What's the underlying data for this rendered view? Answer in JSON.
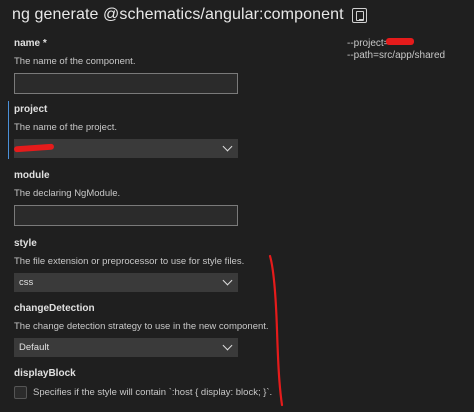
{
  "header": {
    "title": "ng generate @schematics/angular:component",
    "copy_icon": "copy-icon"
  },
  "side_note": {
    "line1": "--project=",
    "line2": "--path=src/app/shared"
  },
  "fields": {
    "name": {
      "label": "name *",
      "description": "The name of the component.",
      "value": ""
    },
    "project": {
      "label": "project",
      "description": "The name of the project.",
      "value": ""
    },
    "module": {
      "label": "module",
      "description": "The declaring NgModule.",
      "value": ""
    },
    "style": {
      "label": "style",
      "description": "The file extension or preprocessor to use for style files.",
      "value": "css"
    },
    "changeDetection": {
      "label": "changeDetection",
      "description": "The change detection strategy to use in the new component.",
      "value": "Default"
    },
    "displayBlock": {
      "label": "displayBlock",
      "description": "Specifies if the style will contain `:host { display: block; }`."
    }
  },
  "colors": {
    "annotation": "#e51b1b",
    "focus": "#4a90d9"
  }
}
